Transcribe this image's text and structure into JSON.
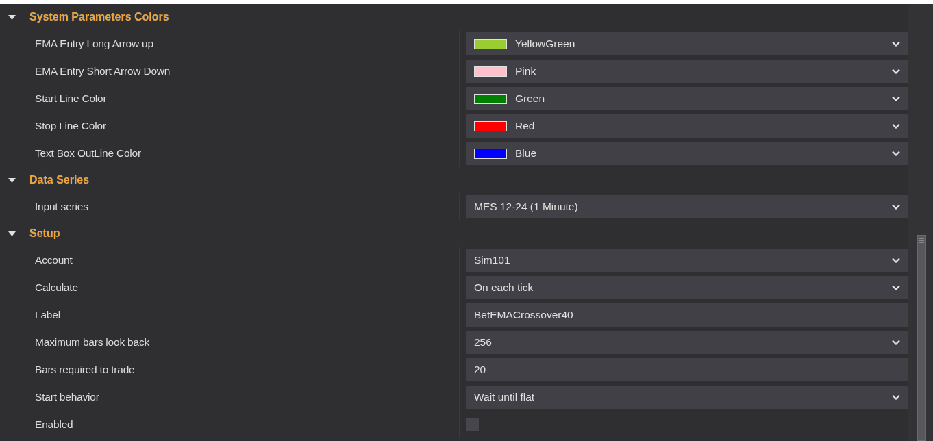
{
  "sections": [
    {
      "title": "System Parameters Colors",
      "expanded": true,
      "rows": [
        {
          "label": "EMA Entry Long Arrow up",
          "kind": "color",
          "value": "YellowGreen",
          "color": "#9acd32"
        },
        {
          "label": "EMA Entry Short Arrow Down",
          "kind": "color",
          "value": "Pink",
          "color": "#ffc0cb"
        },
        {
          "label": "Start Line Color",
          "kind": "color",
          "value": "Green",
          "color": "#008000"
        },
        {
          "label": "Stop Line Color",
          "kind": "color",
          "value": "Red",
          "color": "#ff0000"
        },
        {
          "label": "Text Box OutLine Color",
          "kind": "color",
          "value": "Blue",
          "color": "#0000ff"
        }
      ]
    },
    {
      "title": "Data Series",
      "expanded": true,
      "rows": [
        {
          "label": "Input series",
          "kind": "dropdown",
          "value": "MES 12-24 (1 Minute)"
        }
      ]
    },
    {
      "title": "Setup",
      "expanded": true,
      "rows": [
        {
          "label": "Account",
          "kind": "dropdown",
          "value": "Sim101"
        },
        {
          "label": "Calculate",
          "kind": "dropdown",
          "value": "On each tick"
        },
        {
          "label": "Label",
          "kind": "text",
          "value": "BetEMACrossover40"
        },
        {
          "label": "Maximum bars look back",
          "kind": "dropdown",
          "value": "256"
        },
        {
          "label": "Bars required to trade",
          "kind": "text",
          "value": "20"
        },
        {
          "label": "Start behavior",
          "kind": "dropdown",
          "value": "Wait until flat"
        },
        {
          "label": "Enabled",
          "kind": "checkbox",
          "checked": false
        }
      ]
    }
  ]
}
